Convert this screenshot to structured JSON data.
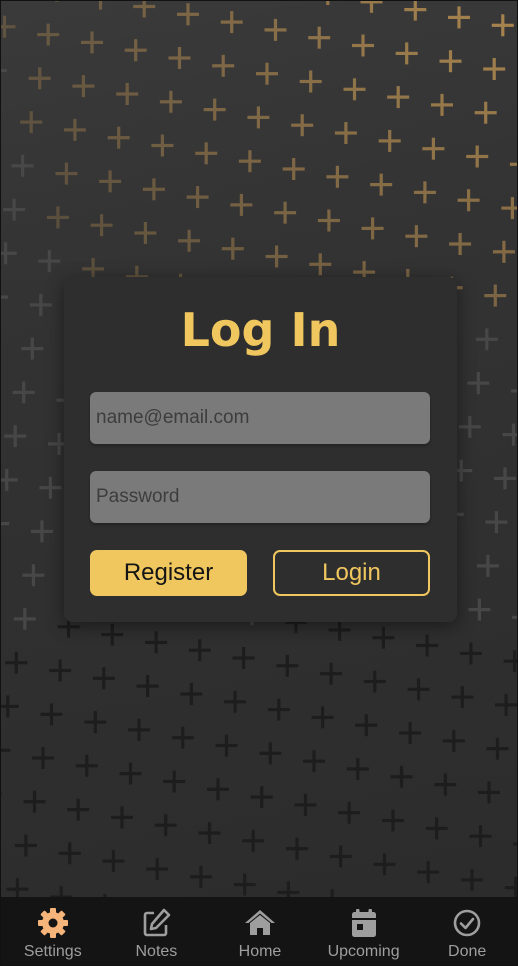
{
  "login": {
    "title": "Log In",
    "email_placeholder": "name@email.com",
    "password_placeholder": "Password",
    "register_label": "Register",
    "login_label": "Login"
  },
  "tabs": [
    {
      "label": "Settings",
      "icon": "gear-icon",
      "active": true
    },
    {
      "label": "Notes",
      "icon": "edit-icon",
      "active": false
    },
    {
      "label": "Home",
      "icon": "home-icon",
      "active": false
    },
    {
      "label": "Upcoming",
      "icon": "calendar-icon",
      "active": false
    },
    {
      "label": "Done",
      "icon": "check-circle-icon",
      "active": false
    }
  ],
  "colors": {
    "accent": "#f0c75e",
    "active_tab_icon": "#f5b57a",
    "inactive_tab": "#9e9e9e",
    "tab_bar": "#141414",
    "card": "#2e2e2e",
    "input": "#7a7a7a"
  }
}
